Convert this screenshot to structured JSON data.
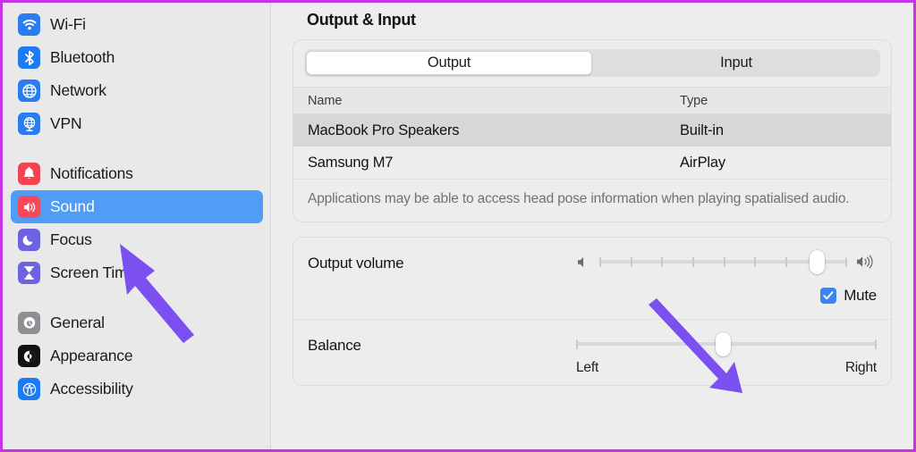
{
  "window": {
    "accent_border": "#c832e6",
    "sidebar_bg": "#e9e9e9",
    "main_bg": "#ededed",
    "selection_blue": "#4f9df7",
    "annotation_purple": "#7c4ff0"
  },
  "sidebar": {
    "groups": [
      {
        "items": [
          {
            "label": "Wi-Fi",
            "icon": "wifi-icon",
            "icon_color": "#2a7df0",
            "selected": false
          },
          {
            "label": "Bluetooth",
            "icon": "bluetooth-icon",
            "icon_color": "#1c7bf2",
            "selected": false
          },
          {
            "label": "Network",
            "icon": "globe-icon",
            "icon_color": "#2a7df0",
            "selected": false
          },
          {
            "label": "VPN",
            "icon": "vpn-globe-icon",
            "icon_color": "#2a7df0",
            "selected": false
          }
        ]
      },
      {
        "items": [
          {
            "label": "Notifications",
            "icon": "bell-icon",
            "icon_color": "#f04452",
            "selected": false
          },
          {
            "label": "Sound",
            "icon": "speaker-icon",
            "icon_color": "#f44a5c",
            "selected": true
          },
          {
            "label": "Focus",
            "icon": "moon-icon",
            "icon_color": "#6d63e0",
            "selected": false
          },
          {
            "label": "Screen Time",
            "icon": "hourglass-icon",
            "icon_color": "#6d63e0",
            "selected": false
          }
        ]
      },
      {
        "items": [
          {
            "label": "General",
            "icon": "gear-icon",
            "icon_color": "#8e8e93",
            "selected": false
          },
          {
            "label": "Appearance",
            "icon": "appearance-contrast-icon",
            "icon_color": "#121212",
            "selected": false
          },
          {
            "label": "Accessibility",
            "icon": "accessibility-person-icon",
            "icon_color": "#1c7bf2",
            "selected": false
          }
        ]
      }
    ]
  },
  "main": {
    "title": "Output & Input",
    "tabs": [
      {
        "label": "Output",
        "active": true
      },
      {
        "label": "Input",
        "active": false
      }
    ],
    "device_table": {
      "columns": [
        "Name",
        "Type"
      ],
      "rows": [
        {
          "name": "MacBook Pro Speakers",
          "type": "Built-in",
          "selected": true
        },
        {
          "name": "Samsung M7",
          "type": "AirPlay",
          "selected": false
        }
      ]
    },
    "table_note": "Applications may be able to access head pose information when playing spatialised audio.",
    "output_volume": {
      "label": "Output volume",
      "value_percent": 88,
      "tick_count": 7,
      "low_icon": "speaker-low-icon",
      "high_icon": "speaker-high-icon"
    },
    "mute": {
      "label": "Mute",
      "checked": true
    },
    "balance": {
      "label": "Balance",
      "value_percent": 49,
      "left_label": "Left",
      "right_label": "Right"
    }
  },
  "annotations": [
    {
      "name": "arrow-to-sound-item",
      "direction": "up-left",
      "color": "#7c4ff0"
    },
    {
      "name": "arrow-to-balance-thumb",
      "direction": "down-right",
      "color": "#7c4ff0"
    }
  ]
}
